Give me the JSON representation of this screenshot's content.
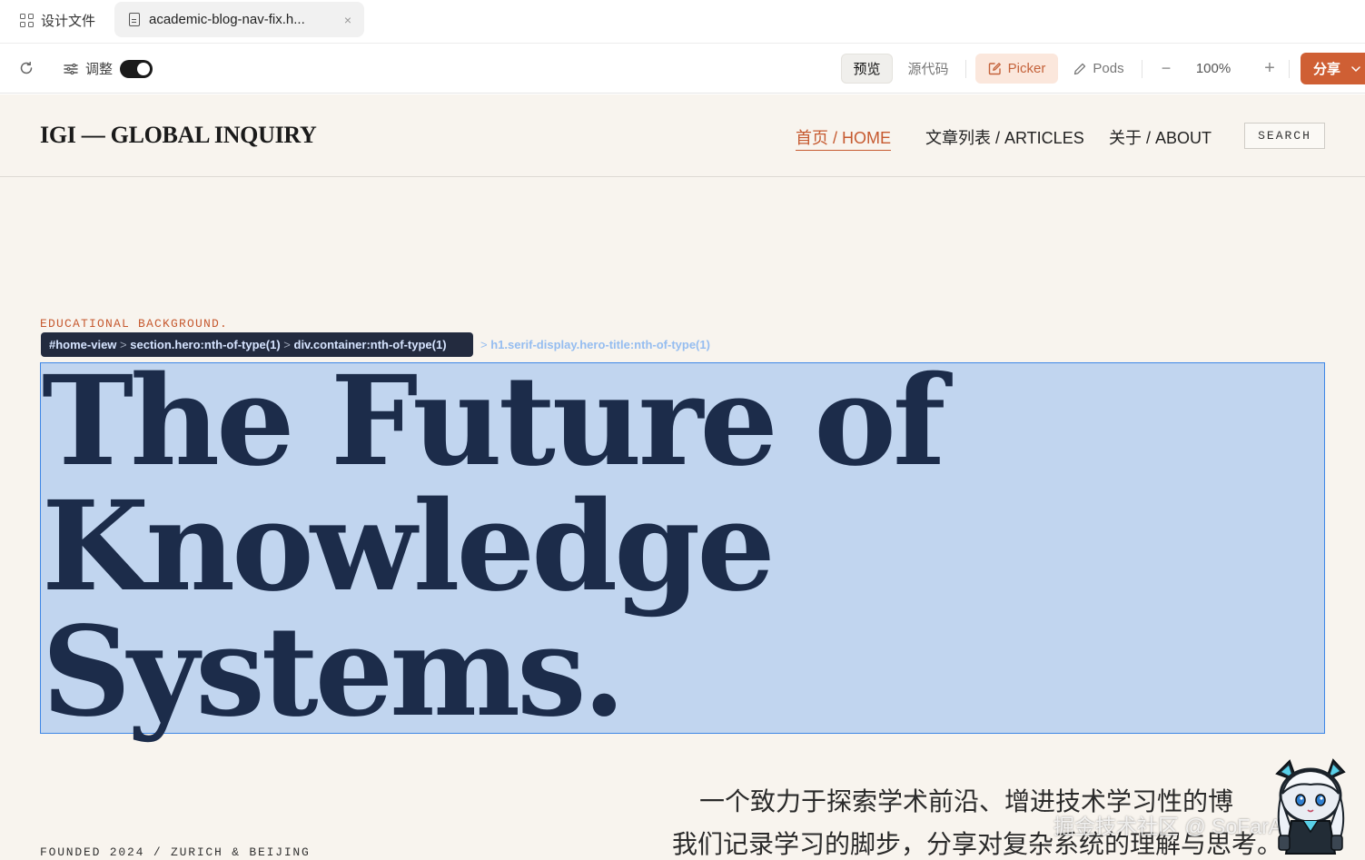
{
  "tabs": {
    "design_label": "设计文件",
    "file_label": "academic-blog-nav-fix.h...",
    "close_glyph": "×"
  },
  "toolbar": {
    "adjust_label": "调整",
    "adjust_toggle_on": true,
    "preview_label": "预览",
    "source_label": "源代码",
    "picker_label": "Picker",
    "pods_label": "Pods",
    "zoom_minus": "−",
    "zoom_value": "100%",
    "zoom_plus": "+",
    "share_label": "分享",
    "share_caret": "⌄",
    "accent_color": "#cf5f34"
  },
  "site": {
    "title": "IGI — GLOBAL INQUIRY",
    "nav": [
      {
        "label": "首页 / HOME",
        "active": true
      },
      {
        "label": "文章列表 / ARTICLES",
        "active": false
      },
      {
        "label": "关于 / ABOUT",
        "active": false
      }
    ],
    "search_label": "SEARCH",
    "eyebrow": "EDUCATIONAL BACKGROUND.",
    "hero_lines": [
      "The Future of",
      "Knowledge",
      "Systems."
    ],
    "subtitle_line1": "一个致力于探索学术前沿、增进技术学习性的博",
    "subtitle_line2": "我们记录学习的脚步，分享对复杂系统的理解与思考。",
    "founded": "FOUNDED 2024 / ZURICH & BEIJING",
    "accent_color": "#c65a30",
    "hero_color": "#1c2c4a"
  },
  "picker_overlay": {
    "crumbs_dark": [
      "#home-view",
      "section.hero:nth-of-type(1)",
      "div.container:nth-of-type(1)"
    ],
    "crumb_separator": ">",
    "crumb_light": "h1.serif-display.hero-title:nth-of-type(1)",
    "highlight_color": "#3f87e6"
  },
  "watermark": "掘金技术社区 @ SoFarAway"
}
